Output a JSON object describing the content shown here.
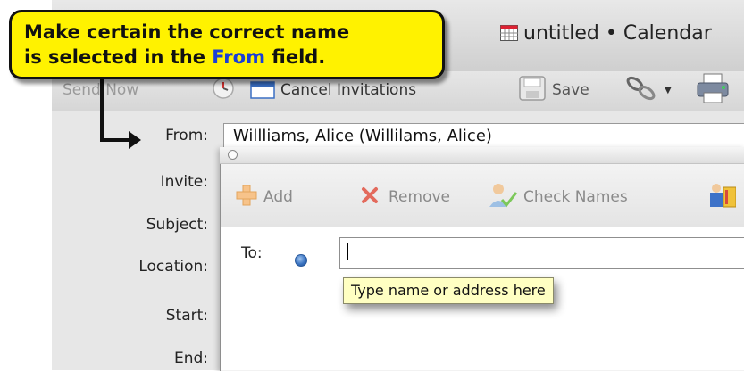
{
  "window": {
    "title": "untitled • Calendar"
  },
  "toolbar": {
    "send_now_label": "Send Now",
    "cancel_invitations_label": "Cancel Invitations",
    "save_label": "Save"
  },
  "form": {
    "from_label": "From:",
    "from_value": "Willliams, Alice (Willilams, Alice)",
    "invite_label": "Invite:",
    "subject_label": "Subject:",
    "location_label": "Location:",
    "start_label": "Start:",
    "end_label": "End:"
  },
  "picker": {
    "add_label": "Add",
    "remove_label": "Remove",
    "check_names_label": "Check Names",
    "to_label": "To:",
    "to_value": "",
    "tooltip": "Type name or address here"
  },
  "callout": {
    "line1": "Make certain the correct name",
    "line2_prefix": "is selected in the ",
    "line2_highlight": "From",
    "line2_suffix": " field."
  },
  "colors": {
    "callout_bg": "#fff200",
    "callout_highlight": "#1a3fd6",
    "tooltip_bg": "#ffffc2"
  }
}
